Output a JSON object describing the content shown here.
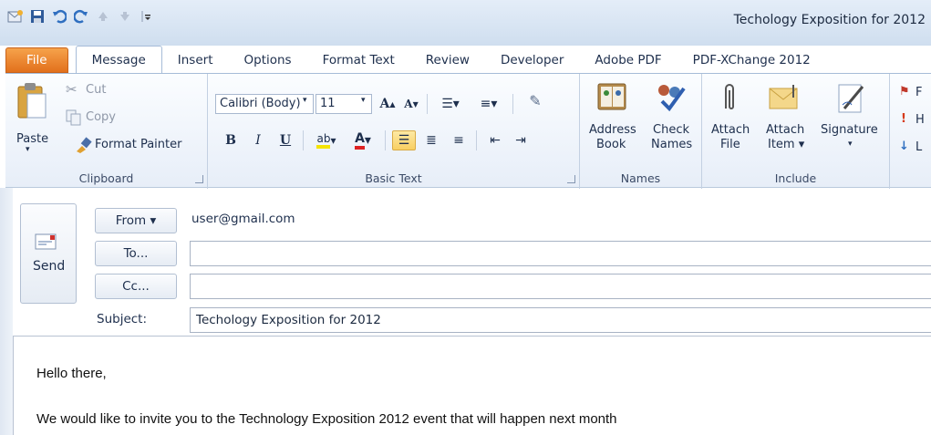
{
  "window": {
    "title": "Techology Exposition for 2012"
  },
  "qat": {
    "icons": [
      "outlook-icon",
      "save-icon",
      "undo-icon",
      "redo-icon",
      "up-arrow-icon",
      "down-arrow-icon",
      "customize-icon"
    ]
  },
  "tabs": [
    {
      "label": "File"
    },
    {
      "label": "Message"
    },
    {
      "label": "Insert"
    },
    {
      "label": "Options"
    },
    {
      "label": "Format Text"
    },
    {
      "label": "Review"
    },
    {
      "label": "Developer"
    },
    {
      "label": "Adobe PDF"
    },
    {
      "label": "PDF-XChange 2012"
    }
  ],
  "ribbon": {
    "clipboard": {
      "label": "Clipboard",
      "paste": "Paste",
      "cut": "Cut",
      "copy": "Copy",
      "format_painter": "Format Painter"
    },
    "basic_text": {
      "label": "Basic Text",
      "font": "Calibri (Body)",
      "font_size": "11",
      "bold": "B",
      "italic": "I",
      "underline": "U"
    },
    "names": {
      "label": "Names",
      "address_book": [
        "Address",
        "Book"
      ],
      "check_names": [
        "Check",
        "Names"
      ]
    },
    "include": {
      "label": "Include",
      "attach_file": [
        "Attach",
        "File"
      ],
      "attach_item": [
        "Attach",
        "Item ▾"
      ],
      "signature": "Signature"
    },
    "tags": {
      "items": [
        "F",
        "H",
        "L"
      ]
    }
  },
  "form": {
    "send": "Send",
    "from_label": "From ▾",
    "from_value": "user@gmail.com",
    "to_label": "To...",
    "to_value": "",
    "cc_label": "Cc...",
    "cc_value": "",
    "subject_label": "Subject:",
    "subject_value": "Techology Exposition for 2012"
  },
  "body": {
    "lines": [
      "Hello there,",
      "We would like to invite you to the Technology Exposition 2012 event that will happen next month"
    ]
  },
  "colors": {
    "file_tab": "#e2701c",
    "ribbon_bg": "#e7eef8",
    "accent": "#1e395b"
  }
}
